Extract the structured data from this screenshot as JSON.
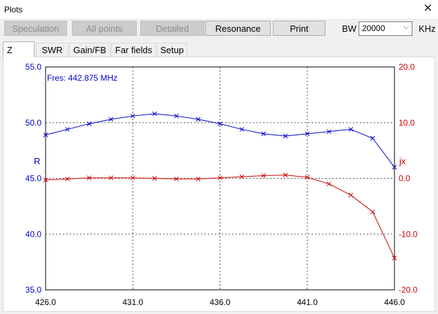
{
  "window": {
    "title": "Plots"
  },
  "toolbar": {
    "buttons": [
      {
        "label": "Speculation",
        "enabled": false
      },
      {
        "label": "All points",
        "enabled": false
      },
      {
        "label": "Detailed",
        "enabled": false
      },
      {
        "label": "Resonance",
        "enabled": true
      },
      {
        "label": "Print",
        "enabled": true
      }
    ],
    "bw_label": "BW",
    "bw_value": "20000",
    "bw_unit": "KHz"
  },
  "tabs": [
    {
      "label": "Z",
      "active": true
    },
    {
      "label": "SWR",
      "active": false
    },
    {
      "label": "Gain/FB",
      "active": false
    },
    {
      "label": "Far fields",
      "active": false
    },
    {
      "label": "Setup",
      "active": false
    }
  ],
  "chart_data": {
    "type": "line",
    "annotation": "Fres: 442.875 MHz",
    "x_ticks": [
      "426.0",
      "431.0",
      "436.0",
      "441.0",
      "446.0"
    ],
    "xlim": [
      426,
      446
    ],
    "left_axis": {
      "label": "R",
      "ylim": [
        35,
        55
      ],
      "ticks": [
        "55.0",
        "50.0",
        "45.0",
        "40.0",
        "35.0"
      ]
    },
    "right_axis": {
      "label": "jx",
      "ylim": [
        -20,
        20
      ],
      "ticks": [
        "20.0",
        "10.0",
        "0.0",
        "-10.0",
        "-20.0"
      ]
    },
    "grid": true,
    "series": [
      {
        "name": "R",
        "axis": "left",
        "color": "#0000cc",
        "x": [
          426,
          427.25,
          428.5,
          429.75,
          431,
          432.25,
          433.5,
          434.75,
          436,
          437.25,
          438.5,
          439.75,
          441,
          442.25,
          443.5,
          444.75,
          446
        ],
        "y": [
          48.9,
          49.4,
          49.9,
          50.3,
          50.6,
          50.8,
          50.6,
          50.3,
          49.9,
          49.4,
          49.0,
          48.8,
          49.0,
          49.2,
          49.4,
          48.6,
          46.0
        ]
      },
      {
        "name": "jx",
        "axis": "right",
        "color": "#cc0000",
        "x": [
          426,
          427.25,
          428.5,
          429.75,
          431,
          432.25,
          433.5,
          434.75,
          436,
          437.25,
          438.5,
          439.75,
          441,
          442.25,
          443.5,
          444.75,
          446
        ],
        "y": [
          -0.3,
          -0.1,
          0.1,
          0.1,
          0.1,
          0.0,
          -0.1,
          -0.1,
          0.1,
          0.3,
          0.5,
          0.6,
          0.2,
          -1.0,
          -3.0,
          -6.0,
          -14.3
        ]
      }
    ]
  }
}
